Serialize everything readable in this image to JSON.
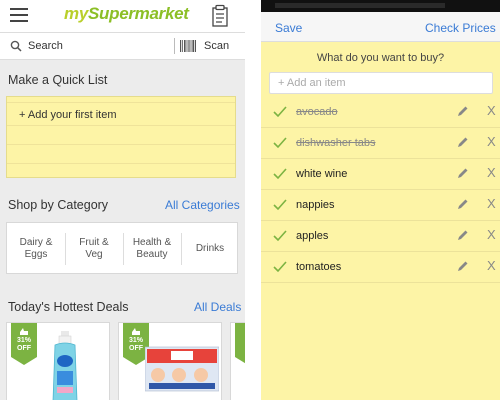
{
  "left": {
    "logo": {
      "my": "my",
      "brand": "Supermarket"
    },
    "search": {
      "label": "Search",
      "scan_label": "Scan"
    },
    "quick_list": {
      "title": "Make a Quick List",
      "add_label": "+ Add your first item"
    },
    "categories": {
      "title": "Shop by Category",
      "link": "All Categories",
      "items": [
        {
          "line1": "Dairy &",
          "line2": "Eggs"
        },
        {
          "line1": "Fruit &",
          "line2": "Veg"
        },
        {
          "line1": "Health &",
          "line2": "Beauty"
        },
        {
          "line1": "Drinks",
          "line2": ""
        }
      ]
    },
    "deals": {
      "title": "Today's Hottest Deals",
      "link": "All Deals",
      "items": [
        {
          "pct": "31%",
          "off": "OFF"
        },
        {
          "pct": "31%",
          "off": "OFF"
        }
      ]
    }
  },
  "right": {
    "save_label": "Save",
    "check_prices_label": "Check Prices",
    "prompt": "What do you want to buy?",
    "add_placeholder": "+ Add an item",
    "remove_glyph": "X",
    "items": [
      {
        "label": "avocado",
        "done": true
      },
      {
        "label": "dishwasher tabs",
        "done": true
      },
      {
        "label": "white wine",
        "done": false
      },
      {
        "label": "nappies",
        "done": false
      },
      {
        "label": "apples",
        "done": false
      },
      {
        "label": "tomatoes",
        "done": false
      }
    ]
  },
  "colors": {
    "accent_blue": "#3a7bd5",
    "brand_green": "#8cbf26",
    "note_yellow": "#fdf4a6",
    "check_green": "#7cb342"
  }
}
